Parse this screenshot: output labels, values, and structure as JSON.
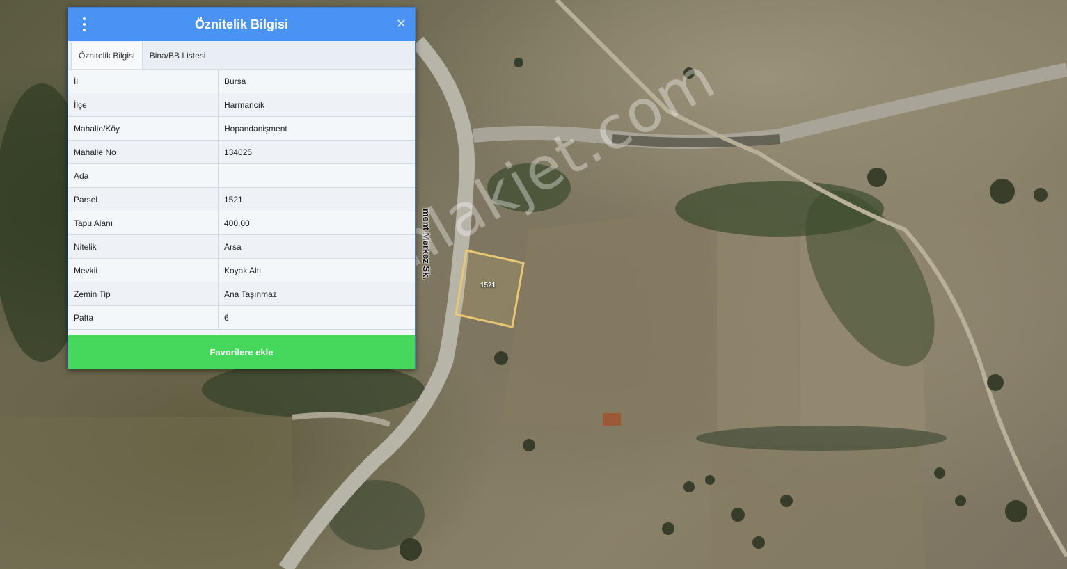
{
  "panel": {
    "title": "Öznitelik Bilgisi",
    "tabs": [
      "Öznitelik Bilgisi",
      "Bina/BB Listesi"
    ],
    "active_tab": 0,
    "rows": [
      {
        "key": "İl",
        "value": "Bursa"
      },
      {
        "key": "İlçe",
        "value": "Harmancık"
      },
      {
        "key": "Mahalle/Köy",
        "value": "Hopandanişment"
      },
      {
        "key": "Mahalle No",
        "value": "134025"
      },
      {
        "key": "Ada",
        "value": ""
      },
      {
        "key": "Parsel",
        "value": "1521"
      },
      {
        "key": "Tapu Alanı",
        "value": "400,00"
      },
      {
        "key": "Nitelik",
        "value": "Arsa"
      },
      {
        "key": "Mevkii",
        "value": "Koyak Altı"
      },
      {
        "key": "Zemin Tip",
        "value": "Ana Taşınmaz"
      },
      {
        "key": "Pafta",
        "value": "6"
      }
    ],
    "favorite_button": "Favorilere ekle",
    "close_icon": "close-icon",
    "menu_icon": "vertical-dots-icon",
    "header_color": "#4a93f5",
    "button_color": "#45d85c"
  },
  "map": {
    "street_label": "ment Merkez Sk.",
    "parcel_label": "1521",
    "parcel_outline_color": "#e8c776",
    "watermark": "emlakjet.com"
  }
}
